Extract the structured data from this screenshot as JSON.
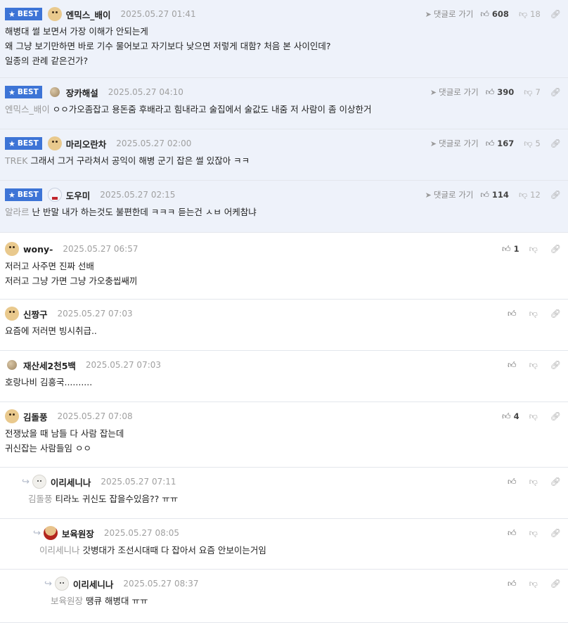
{
  "comments": [
    {
      "best": true,
      "badge": "BEST",
      "avatar": "dog",
      "author": "엔믹스_배이",
      "time": "2025.05.27 01:41",
      "reply_link": "댓글로 가기",
      "up": "608",
      "down": "18",
      "lines": [
        "해병대 썰 보면서 가장 이해가 안되는게",
        "왜 그냥 보기만하면 바로 기수 물어보고 자기보다 낮으면 저렇게 대함? 처음 본 사이인데?",
        "일종의 관례 같은건가?"
      ]
    },
    {
      "best": true,
      "badge": "BEST",
      "avatar": "ball",
      "author": "장카해설",
      "time": "2025.05.27 04:10",
      "reply_link": "댓글로 가기",
      "up": "390",
      "down": "7",
      "mention": "엔믹스_배이",
      "lines": [
        "ㅇㅇ가오좀잡고 용돈줌 후배라고 힘내라고 술집에서 술값도 내줌 저 사람이 좀 이상한거"
      ]
    },
    {
      "best": true,
      "badge": "BEST",
      "avatar": "dog",
      "author": "마리오란차",
      "time": "2025.05.27 02:00",
      "reply_link": "댓글로 가기",
      "up": "167",
      "down": "5",
      "mention": "TREK",
      "lines": [
        "그래서 그거 구라쳐서 공익이 해병 군기 잡은 썰 있잖아 ㅋㅋ"
      ]
    },
    {
      "best": true,
      "badge": "BEST",
      "avatar": "snow",
      "author": "도우미",
      "time": "2025.05.27 02:15",
      "reply_link": "댓글로 가기",
      "up": "114",
      "down": "12",
      "mention": "알라르",
      "lines": [
        "난 반말 내가 하는것도 불편한데 ㅋㅋㅋ 듣는건 ㅅㅂ 어케참냐"
      ]
    },
    {
      "best": false,
      "avatar": "dog",
      "author": "wony-",
      "time": "2025.05.27 06:57",
      "up": "1",
      "down": "",
      "lines": [
        "저러고 사주면 진짜 선배",
        "저러고 그냥 가면 그냥 가오충씹쌔끼"
      ]
    },
    {
      "best": false,
      "avatar": "dog",
      "author": "신짱구",
      "time": "2025.05.27 07:03",
      "up": "",
      "down": "",
      "lines": [
        "요즘에 저러면 빙시취급.."
      ]
    },
    {
      "best": false,
      "avatar": "ball",
      "author": "재산세2천5백",
      "time": "2025.05.27 07:03",
      "up": "",
      "down": "",
      "lines": [
        "호랑나비 김흥국.........."
      ]
    },
    {
      "best": false,
      "avatar": "dog",
      "author": "김돌풍",
      "time": "2025.05.27 07:08",
      "up": "4",
      "down": "",
      "lines": [
        "전쟁났을 때 남들 다 사람 잡는데",
        "귀신잡는 사람들임 ㅇㅇ"
      ]
    },
    {
      "best": false,
      "avatar": "white",
      "author": "이리세니나",
      "time": "2025.05.27 07:11",
      "up": "",
      "down": "",
      "mention": "김돌풍",
      "lines": [
        "티라노 귀신도 잡을수있음?? ㅠㅠ"
      ]
    },
    {
      "best": false,
      "avatar": "red",
      "author": "보육원장",
      "time": "2025.05.27 08:05",
      "up": "",
      "down": "",
      "mention": "이리세니나",
      "lines": [
        "갓병대가 조선시대때 다 잡아서 요즘 안보이는거임"
      ]
    },
    {
      "best": false,
      "avatar": "white",
      "author": "이리세니나",
      "time": "2025.05.27 08:37",
      "up": "",
      "down": "",
      "mention": "보육원장",
      "lines": [
        "땡큐 해병대 ㅠㅠ"
      ]
    }
  ],
  "icons": {
    "thumb_up": "thumb-up-icon",
    "thumb_down": "thumb-down-icon",
    "link": "link-icon",
    "reply": "reply-arrow-icon",
    "best_star": "star-icon"
  },
  "colors": {
    "best_bg": "#eef2fa",
    "badge": "#3d74d6"
  }
}
